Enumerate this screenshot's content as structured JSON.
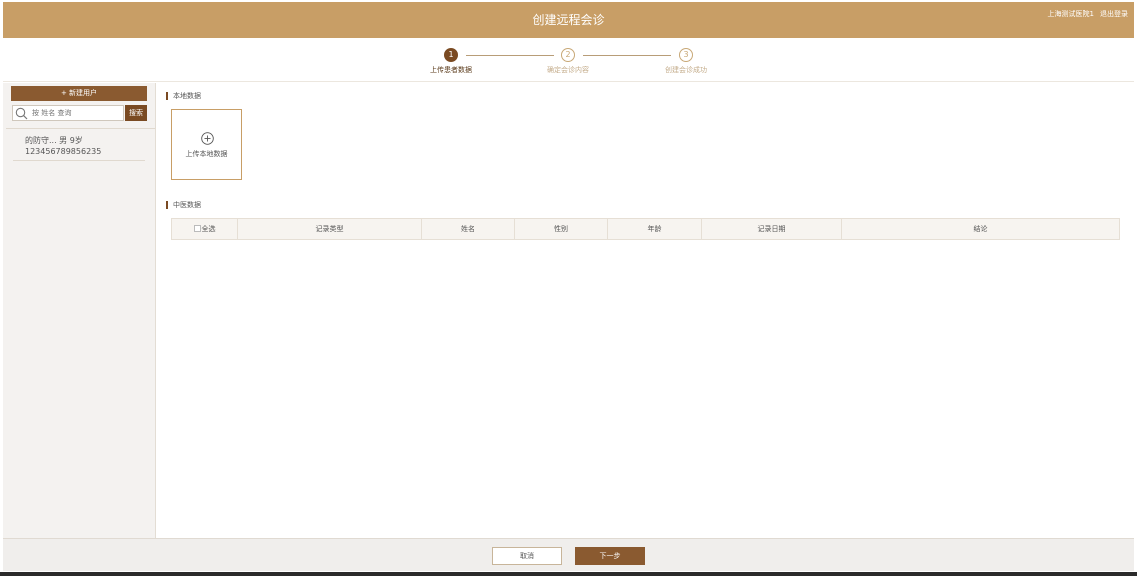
{
  "header": {
    "title": "创建远程会诊",
    "user": "上海测试医院1",
    "logout": "退出登录"
  },
  "steps": [
    {
      "number": "1",
      "label": "上传患者数据",
      "active": true
    },
    {
      "number": "2",
      "label": "确定会诊内容",
      "active": false
    },
    {
      "number": "3",
      "label": "创建会诊成功",
      "active": false
    }
  ],
  "sidebar": {
    "new_user": "+ 新建用户",
    "search_placeholder": "按 姓名 查询",
    "search_button": "搜索",
    "patients": [
      {
        "name_gender_age": "的防守...   男   9岁",
        "id": "123456789856235"
      }
    ]
  },
  "main": {
    "local_section": "本地数据",
    "upload_label": "上传本地数据",
    "tcm_section": "中医数据",
    "table_headers": {
      "select_all": "全选",
      "record_type": "记录类型",
      "name": "姓名",
      "gender": "性别",
      "age": "年龄",
      "record_date": "记录日期",
      "conclusion": "结论"
    }
  },
  "footer": {
    "cancel": "取消",
    "next": "下一步"
  },
  "colors": {
    "header": "#c89e66",
    "primary": "#8a5a30",
    "active_step": "#7a4a22"
  }
}
